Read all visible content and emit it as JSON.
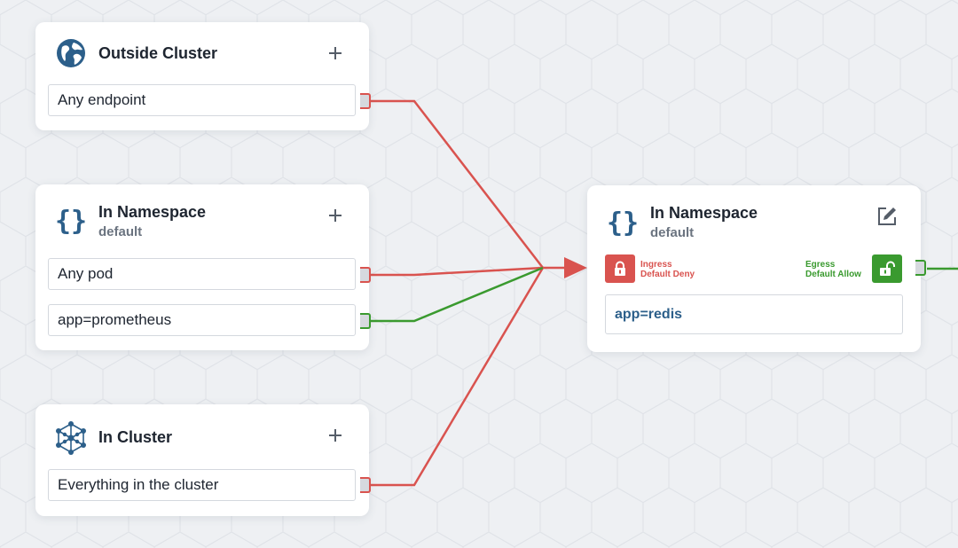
{
  "cards": {
    "outside_cluster": {
      "title": "Outside Cluster",
      "icon": "globe-icon",
      "selectors": [
        "Any endpoint"
      ]
    },
    "in_namespace_source": {
      "title": "In Namespace",
      "subtitle": "default",
      "icon": "braces-icon",
      "selectors": [
        "Any pod",
        "app=prometheus"
      ]
    },
    "in_cluster": {
      "title": "In Cluster",
      "icon": "cluster-icon",
      "selectors": [
        "Everything in the cluster"
      ]
    },
    "target": {
      "title": "In Namespace",
      "subtitle": "default",
      "icon": "braces-icon",
      "edit_icon": "edit-icon",
      "ingress": {
        "label": "Ingress",
        "policy": "Default Deny",
        "icon": "lock-closed-icon",
        "color": "#d9534f"
      },
      "egress": {
        "label": "Egress",
        "policy": "Default Allow",
        "icon": "lock-open-icon",
        "color": "#3a9a2f"
      },
      "selector": "app=redis"
    }
  },
  "colors": {
    "deny": "#d9534f",
    "allow": "#3a9a2f",
    "icon_blue": "#2c5f8a",
    "background": "#eef0f3"
  }
}
